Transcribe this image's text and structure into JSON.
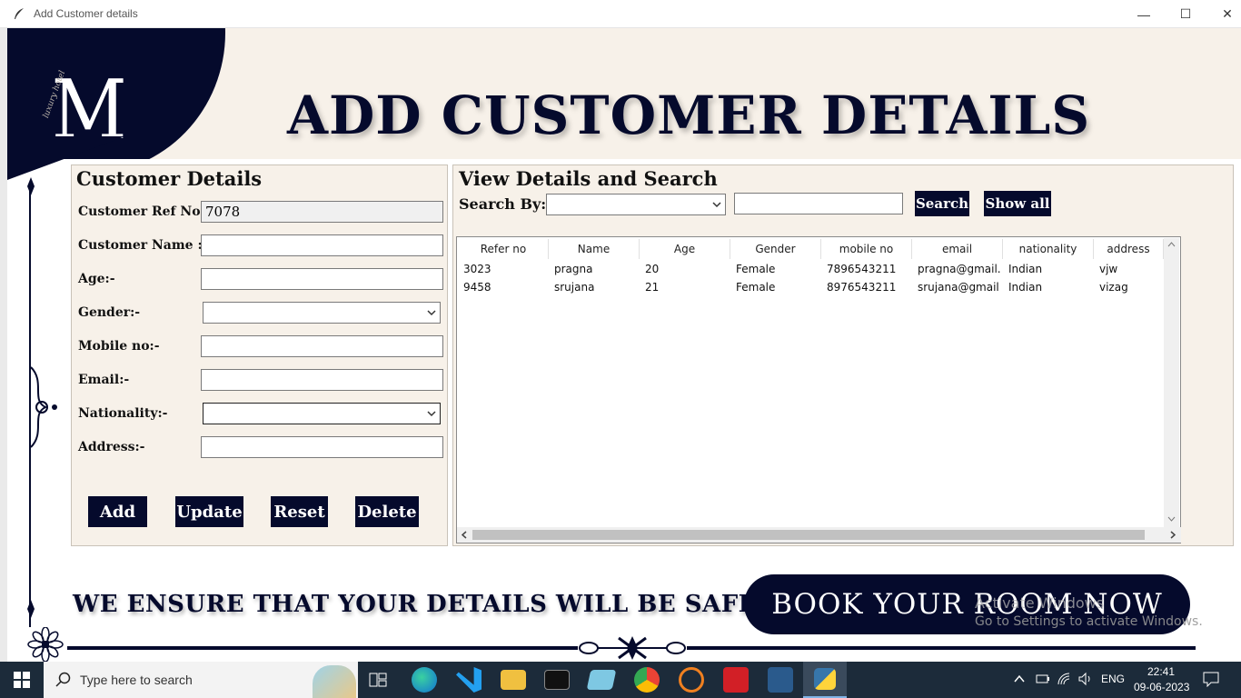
{
  "window": {
    "title": "Add Customer details",
    "minimize": "—",
    "maximize": "☐",
    "close": "✕"
  },
  "header": {
    "logo_letter": "M",
    "logo_script": "luxury hotel",
    "page_title": "ADD CUSTOMER DETAILS"
  },
  "customer_form": {
    "title": "Customer Details",
    "fields": {
      "ref_label": "Customer Ref No:-",
      "ref_value": "7078",
      "name_label": "Customer Name :-",
      "name_value": "",
      "age_label": "Age:-",
      "age_value": "",
      "gender_label": "Gender:-",
      "gender_value": "",
      "mobile_label": "Mobile no:-",
      "mobile_value": "",
      "email_label": "Email:-",
      "email_value": "",
      "nationality_label": "Nationality:-",
      "nationality_value": "",
      "address_label": "Address:-",
      "address_value": ""
    },
    "buttons": {
      "add": "Add",
      "update": "Update",
      "reset": "Reset",
      "delete": "Delete"
    }
  },
  "view_panel": {
    "title": "View Details and Search",
    "search_by_label": "Search By:",
    "search_by_value": "",
    "search_text": "",
    "search_button": "Search",
    "show_all_button": "Show all",
    "columns": [
      "Refer no",
      "Name",
      "Age",
      "Gender",
      "mobile no",
      "email",
      "nationality",
      "address"
    ],
    "rows": [
      [
        "3023",
        "pragna",
        "20",
        "Female",
        "7896543211",
        "pragna@gmail.cc",
        "Indian",
        "vjw"
      ],
      [
        "9458",
        "srujana",
        "21",
        "Female",
        "8976543211",
        "srujana@gmail.cc",
        "Indian",
        "vizag"
      ]
    ]
  },
  "footer": {
    "slogan": "WE ENSURE THAT YOUR DETAILS WILL BE SAFE.",
    "book_button": "BOOK YOUR ROOM NOW",
    "watermark_line1": "Activate Windows",
    "watermark_line2": "Go to Settings to activate Windows."
  },
  "taskbar": {
    "search_placeholder": "Type here to search",
    "language": "ENG",
    "time": "22:41",
    "date": "09-06-2023"
  },
  "colors": {
    "navy": "#050a2c",
    "cream": "#f7f1e9",
    "taskbar": "#1c2b3a"
  }
}
